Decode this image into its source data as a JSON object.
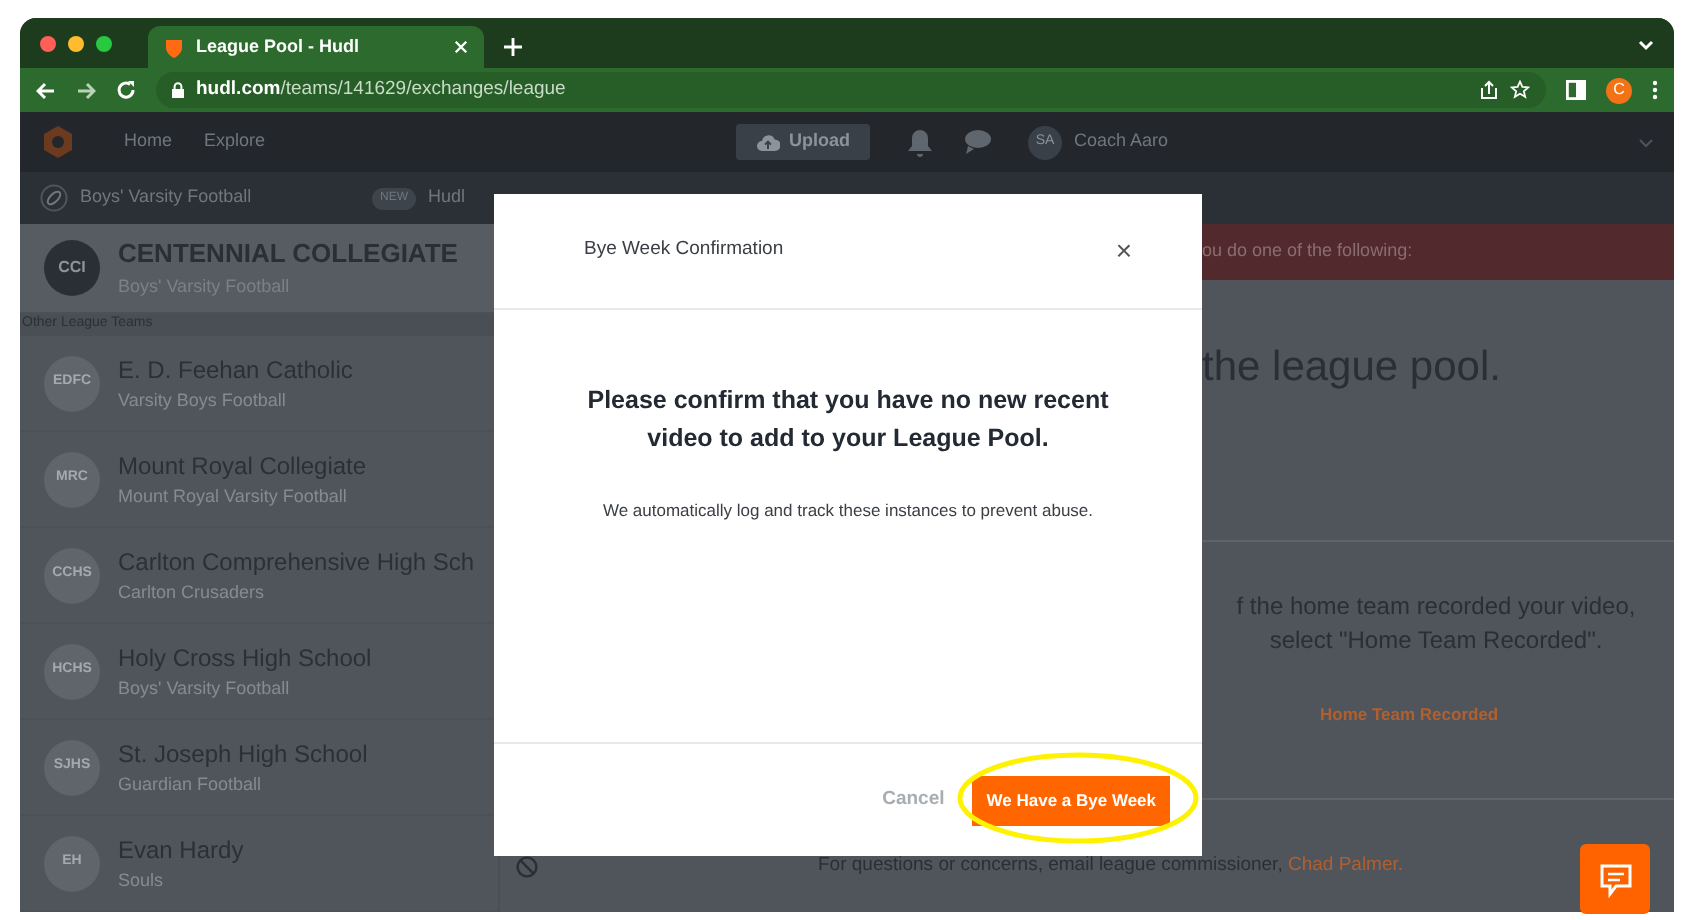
{
  "browser": {
    "tab_title": "League Pool - Hudl",
    "url_host": "hudl.com",
    "url_path": "/teams/141629/exchanges/league",
    "profile_initial": "C"
  },
  "top_nav": {
    "links": [
      "Home",
      "Explore"
    ],
    "upload": "Upload",
    "user_initials": "SA",
    "user_name": "Coach Aaro"
  },
  "sub_nav": {
    "team": "Boys' Varsity Football",
    "badge": "NEW",
    "link": "Hudl"
  },
  "sidebar": {
    "current_team": {
      "initials": "CCI",
      "name": "CENTENNIAL COLLEGIATE",
      "sport": "Boys' Varsity Football"
    },
    "section": "Other League Teams",
    "teams": [
      {
        "initials": "EDFC",
        "name": "E. D. Feehan Catholic",
        "sport": "Varsity Boys Football"
      },
      {
        "initials": "MRC",
        "name": "Mount Royal Collegiate",
        "sport": "Mount Royal Varsity Football"
      },
      {
        "initials": "CCHS",
        "name": "Carlton Comprehensive High Sch",
        "sport": "Carlton Crusaders"
      },
      {
        "initials": "HCHS",
        "name": "Holy Cross High School",
        "sport": "Boys' Varsity Football"
      },
      {
        "initials": "SJHS",
        "name": "St. Joseph High School",
        "sport": "Guardian Football"
      },
      {
        "initials": "EH",
        "name": "Evan Hardy",
        "sport": "Souls"
      }
    ]
  },
  "main": {
    "banner": "ou do one of the following:",
    "heading": "the league pool.",
    "home_team_text": [
      "f the home team recorded your video,",
      "select \"Home Team Recorded\"."
    ],
    "home_team_button": "Home Team Recorded",
    "contact_text": "For questions or concerns, email league commissioner,",
    "contact_link": "Chad Palmer."
  },
  "modal": {
    "title": "Bye Week Confirmation",
    "close": "×",
    "heading": "Please confirm that you have no new recent video to add to your League Pool.",
    "note": "We automatically log and track these instances to prevent abuse.",
    "cancel": "Cancel",
    "confirm": "We Have a Bye Week"
  }
}
